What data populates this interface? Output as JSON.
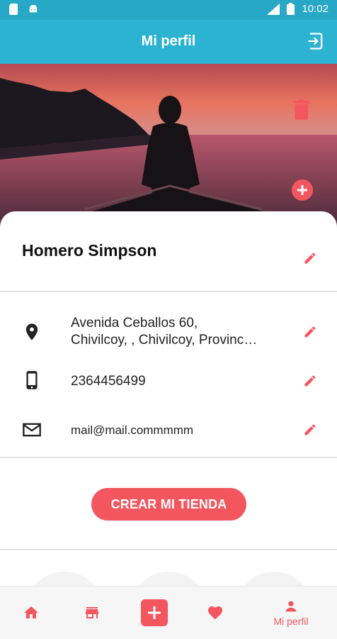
{
  "status_bar": {
    "time": "10:02"
  },
  "app_bar": {
    "title": "Mi perfil"
  },
  "profile": {
    "name": "Homero Simpson",
    "address_line1": "Avenida Ceballos 60,",
    "address_line2": "Chivilcoy, , Chivilcoy, Provinc…",
    "phone": "2364456499",
    "email": "mail@mail.commmmm"
  },
  "actions": {
    "create_store": "CREAR MI TIENDA"
  },
  "bottom_nav": {
    "active_label": "Mi perfil"
  },
  "colors": {
    "primary": "#2bb3d1",
    "accent": "#f4565f"
  }
}
